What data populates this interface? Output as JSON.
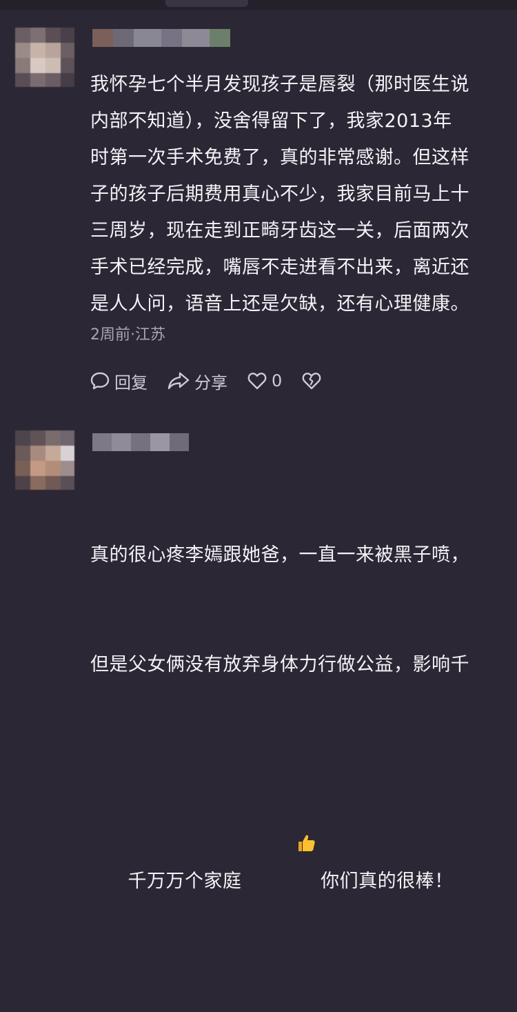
{
  "comments": [
    {
      "text": "我怀孕七个半月发现孩子是唇裂（那时医生说\n内部不知道），没舍得留下了，我家2013年\n时第一次手术免费了，真的非常感谢。但这样\n子的孩子后期费用真心不少，我家目前马上十\n三周岁，现在走到正畸牙齿这一关，后面两次\n手术已经完成，嘴唇不走进看不出来，离近还\n是人人问，语音上还是欠缺，还有心理健康。",
      "meta": "2周前·江苏",
      "actions": {
        "reply_label": "回复",
        "share_label": "分享",
        "like_count": "0"
      }
    },
    {
      "text_line1": "真的很心疼李嫣跟她爸，一直一来被黑子喷，",
      "text_line2": "但是父女俩没有放弃身体力行做公益，影响千",
      "text_line3_before": "千万万个家庭",
      "emoji": "👍",
      "text_line3_after": "你们真的很棒！"
    }
  ],
  "icons": {
    "reply": "comment-bubble-icon",
    "share": "share-arrow-icon",
    "like": "heart-icon",
    "dislike": "broken-heart-icon"
  }
}
